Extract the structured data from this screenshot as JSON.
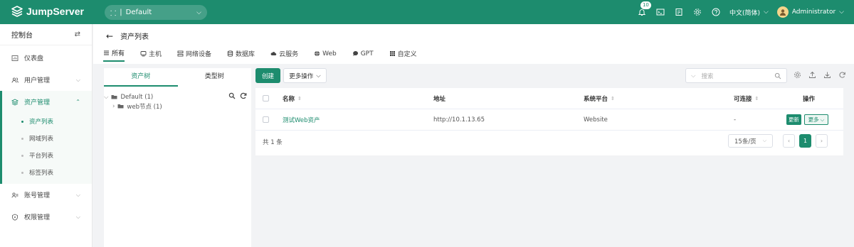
{
  "app": {
    "name": "JumpServer"
  },
  "org": {
    "selected": "Default"
  },
  "topbar": {
    "notification_count": "10",
    "language": "中文(简体)",
    "user": "Administrator",
    "icons": [
      "bell-icon",
      "terminal-icon",
      "tickets-icon",
      "settings-icon",
      "help-icon"
    ]
  },
  "sidebar": {
    "header": "控制台",
    "items": [
      {
        "label": "仪表盘",
        "icon": "dashboard-icon"
      },
      {
        "label": "用户管理",
        "icon": "users-icon"
      },
      {
        "label": "资产管理",
        "icon": "assets-icon"
      },
      {
        "label": "账号管理",
        "icon": "accounts-icon"
      },
      {
        "label": "权限管理",
        "icon": "perms-icon"
      }
    ],
    "asset_subitems": [
      "资产列表",
      "网域列表",
      "平台列表",
      "标签列表"
    ]
  },
  "page": {
    "title": "资产列表",
    "tabs": [
      "所有",
      "主机",
      "网络设备",
      "数据库",
      "云服务",
      "Web",
      "GPT",
      "自定义"
    ]
  },
  "tree": {
    "tabs": [
      "资产树",
      "类型树"
    ],
    "root": "Default (1)",
    "child": "web节点 (1)"
  },
  "toolbar": {
    "create": "创建",
    "more_actions": "更多操作",
    "search_placeholder": "搜索"
  },
  "table": {
    "headers": {
      "name": "名称",
      "address": "地址",
      "platform": "系统平台",
      "connectivity": "可连接",
      "actions": "操作"
    },
    "rows": [
      {
        "name": "测试Web资产",
        "address": "http://10.1.13.65",
        "platform": "Website",
        "connectivity": "-",
        "update": "更新",
        "more": "更多"
      }
    ],
    "total": "共 1 条",
    "page_size": "15条/页",
    "current_page": "1"
  },
  "colors": {
    "brand": "#1d8c6e"
  }
}
